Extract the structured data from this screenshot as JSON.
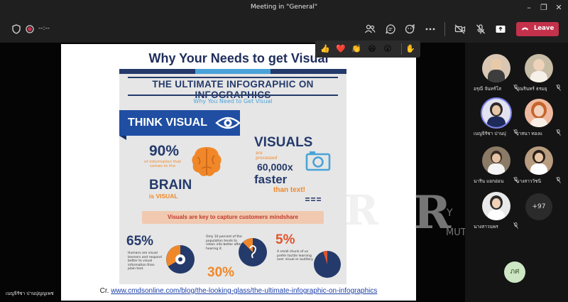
{
  "window": {
    "title": "Meeting in \"General\"",
    "controls": [
      "minimize-icon",
      "restore-icon",
      "close-icon"
    ]
  },
  "toolbar": {
    "timer": "--:--",
    "icons": [
      "shield-icon",
      "record-icon",
      "people-icon",
      "chat-icon",
      "reactions-icon",
      "more-icon",
      "camera-off-icon",
      "mic-off-icon",
      "share-icon"
    ],
    "leave_label": "Leave",
    "leave_color": "#c4314b"
  },
  "reactions": [
    "👍",
    "❤️",
    "👏",
    "😆",
    "😲",
    "✋"
  ],
  "slide": {
    "title": "Why Your Needs to get Visual",
    "credit_prefix": "Cr.",
    "credit_link": "www.cmdsonline.com/blog/the-looking-glass/the-ultimate-infographic-on-infographics"
  },
  "infographic": {
    "title": "THE ULTIMATE INFOGRAPHIC ON INFOGRAPHICS",
    "subtitle": "Why You Need to Get Visual",
    "banner": "THINK VISUAL",
    "stat1_pct": "90%",
    "stat1_small": "of information that comes to the",
    "stat1_brain": "BRAIN",
    "stat1_visual": "is VISUAL",
    "visuals": "VISUALS",
    "visuals_small": "are processed",
    "visuals_num": "60,000x",
    "visuals_faster": "faster",
    "visuals_than": "than text!",
    "mindshare": "Visuals are key to capture customers mindshare",
    "stat2_pct": "65%",
    "stat2_text": "Humans are visual learners and respond better to visual information than plain text.",
    "stat3_text": "Only 10 percent of the population tends to retain info better after hearing it.",
    "stat3_pct": "30%",
    "stat4_pct": "5%",
    "stat4_text": "A small chunk of us prefer tactile learning over visual or auditory."
  },
  "participants": [
    {
      "name": "อรุณี จันทร์โส"
    },
    {
      "name": "ปุณรินทร์ ธรมยุ"
    },
    {
      "name": "เบญจิรัชา ปานปุ"
    },
    {
      "name": "วาสนา ทองแ"
    },
    {
      "name": "นาริน แยกอ่อน"
    },
    {
      "name": "นางสาววัชนิ"
    },
    {
      "name": "นางสาวนพร"
    }
  ],
  "overflow_count": "+97",
  "self_initials": "ภศ",
  "self_name": "เบญจิรัชา ปานปุญญเพช",
  "watermark": {
    "r": "R",
    "y": "Y",
    "mutt": "MUTT"
  }
}
